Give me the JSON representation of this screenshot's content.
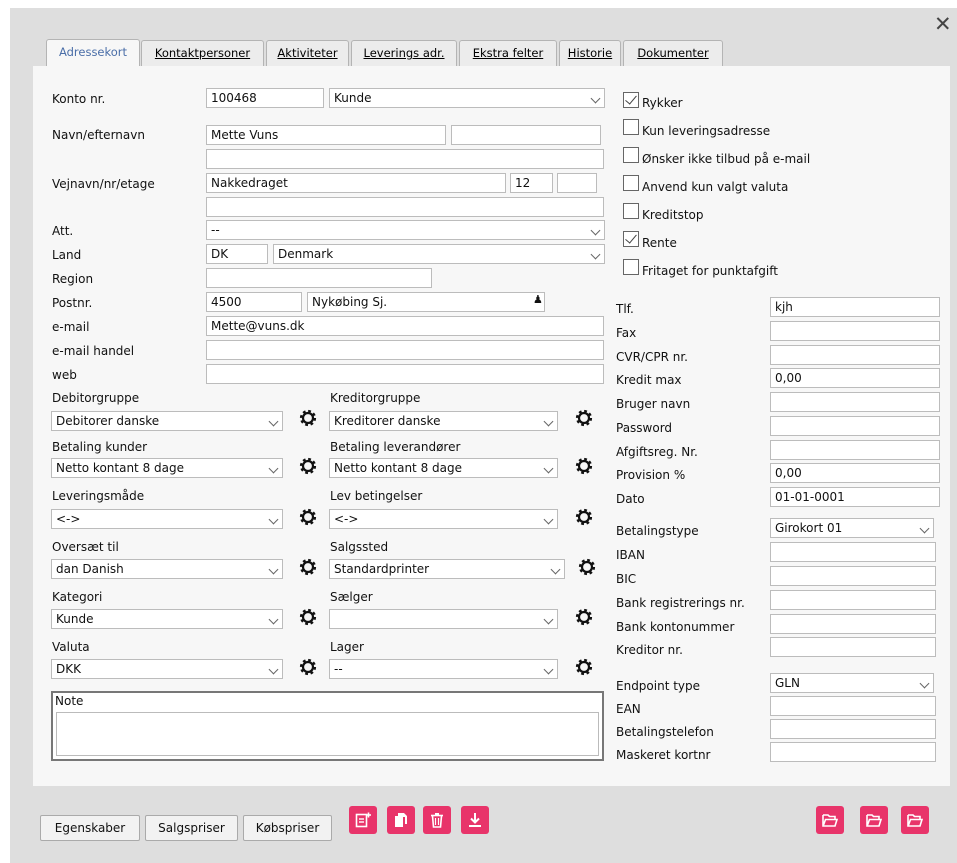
{
  "tabs": [
    "Adressekort",
    "Kontaktpersoner",
    "Aktiviteter",
    "Leverings adr.",
    "Ekstra felter",
    "Historie",
    "Dokumenter"
  ],
  "close_glyph": "✕",
  "left": {
    "konto_label": "Konto nr.",
    "konto_value": "100468",
    "type_value": "Kunde",
    "navn_label": "Navn/efternavn",
    "navn_value": "Mette Vuns",
    "navn2_value": "",
    "navn3_value": "",
    "vej_label": "Vejnavn/nr/etage",
    "vej_value": "Nakkedraget",
    "nr_value": "12",
    "etage_value": "",
    "vej2_value": "",
    "att_label": "Att.",
    "att_value": "--",
    "land_label": "Land",
    "land_code": "DK",
    "land_name": "Denmark",
    "region_label": "Region",
    "region_value": "",
    "post_label": "Postnr.",
    "post_value": "4500",
    "by_value": "Nykøbing Sj.",
    "person_glyph": "♟",
    "email_label": "e-mail",
    "email_value": "Mette@vuns.dk",
    "email_handel_label": "e-mail handel",
    "email_handel_value": "",
    "web_label": "web",
    "web_value": ""
  },
  "groups": [
    {
      "label": "Debitorgruppe",
      "value": "Debitorer danske"
    },
    {
      "label": "Kreditorgruppe",
      "value": "Kreditorer danske"
    },
    {
      "label": "Betaling kunder",
      "value": "Netto kontant 8 dage"
    },
    {
      "label": "Betaling leverandører",
      "value": "Netto kontant 8 dage"
    },
    {
      "label": "Leveringsmåde",
      "value": "<->"
    },
    {
      "label": "Lev betingelser",
      "value": "<->"
    },
    {
      "label": "Oversæt til",
      "value": "dan Danish"
    },
    {
      "label": "Salgssted",
      "value": "Standardprinter"
    },
    {
      "label": "Kategori",
      "value": "Kunde"
    },
    {
      "label": "Sælger",
      "value": ""
    },
    {
      "label": "Valuta",
      "value": "DKK"
    },
    {
      "label": "Lager",
      "value": "--"
    }
  ],
  "note_label": "Note",
  "checkboxes": [
    {
      "label": "Rykker",
      "checked": true
    },
    {
      "label": "Kun leveringsadresse",
      "checked": false
    },
    {
      "label": "Ønsker ikke tilbud på e-mail",
      "checked": false
    },
    {
      "label": "Anvend kun valgt valuta",
      "checked": false
    },
    {
      "label": "Kreditstop",
      "checked": false
    },
    {
      "label": "Rente",
      "checked": true
    },
    {
      "label": "Fritaget for punktafgift",
      "checked": false
    }
  ],
  "right_fields": [
    {
      "label": "Tlf.",
      "value": "kjh"
    },
    {
      "label": "Fax",
      "value": ""
    },
    {
      "label": "CVR/CPR nr.",
      "value": ""
    },
    {
      "label": "Kredit max",
      "value": "0,00"
    },
    {
      "label": "Bruger navn",
      "value": ""
    },
    {
      "label": "Password",
      "value": ""
    },
    {
      "label": "Afgiftsreg. Nr.",
      "value": ""
    },
    {
      "label": "Provision %",
      "value": "0,00"
    },
    {
      "label": "Dato",
      "value": "01-01-0001"
    }
  ],
  "bank": {
    "type_label": "Betalingstype",
    "type_value": "Girokort 01",
    "fields": [
      {
        "label": "IBAN",
        "value": ""
      },
      {
        "label": "BIC",
        "value": ""
      },
      {
        "label": "Bank registrerings nr.",
        "value": ""
      },
      {
        "label": "Bank kontonummer",
        "value": ""
      },
      {
        "label": "Kreditor nr.",
        "value": ""
      }
    ]
  },
  "endpoint": {
    "type_label": "Endpoint type",
    "type_value": "GLN",
    "fields": [
      {
        "label": "EAN",
        "value": ""
      },
      {
        "label": "Betalingstelefon",
        "value": ""
      },
      {
        "label": "Maskeret kortnr",
        "value": ""
      }
    ]
  },
  "buttons": [
    "Egenskaber",
    "Salgspriser",
    "Købspriser"
  ],
  "accent_color": "#e8346a",
  "action_icons": [
    "new-note-icon",
    "copy-icon",
    "trash-icon",
    "download-icon"
  ],
  "folder_icons": [
    "folder-open-icon",
    "folder-open-icon",
    "folder-open-icon"
  ]
}
